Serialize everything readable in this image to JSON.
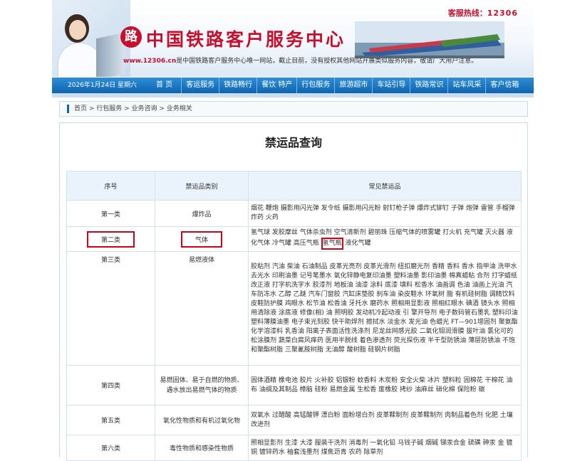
{
  "header": {
    "hotline_label": "客服热线：",
    "hotline_number": "12306",
    "site_title": "中国铁路客户服务中心",
    "notice_url": "www.12306.cn",
    "notice_text": "是中国铁路客户服务中心唯一网站，截止目前，没有授权其他网站开展类似服务内容，敬请广大用户注意。",
    "logo_glyph": "路"
  },
  "nav": {
    "date": "2026年1月24日 星期六",
    "items": [
      "首 页",
      "客运服务",
      "铁路畅行",
      "餐饮 特产",
      "行包服务",
      "旅游超市",
      "车站引导",
      "铁路常识",
      "站车风采",
      "客户信箱"
    ]
  },
  "breadcrumb": "首页 > 行包服务 > 业务咨询 > 业务相关",
  "page_title": "禁运品查询",
  "table": {
    "headers": [
      "序号",
      "禁运品类别",
      "常见禁运品"
    ],
    "rows": [
      {
        "no": "第一类",
        "category": "爆炸品",
        "items": "烟花 鞭炮 摄影用闪光弹 发令纸 摄影用闪光粉 射钉枪子弹 爆炸式铆钉 子弹 炮弹 雷管 手榴弹 炸药 火药"
      },
      {
        "no": "第二类",
        "category": "气体",
        "items_before": "氢气球 发胶摩丝 气体杀虫剂 空气清新剂 碧丽珠 压缩气体的喷雾罐 打火机 充气罐 灭火器 液化气体 冷气罐 高压气瓶 ",
        "items_highlight": "氢气瓶",
        "items_after": " 液化气罐"
      },
      {
        "no": "第三类",
        "category": "易燃液体",
        "items": "胶粘剂 汽油 柴油 石油制品 皮革光亮剂 皮革光滑剂 纽扣磨光剂 香精 香料 香水 指甲油 洗甲水 去光水 印刷油墨 记号笔墨水 氧化锌静电复印油墨 塑料油墨 影印油墨 棉真蜡粘 合剂 打字蜡纸改正液 打字机洗字水 胶漆剂 地板油 油漆 涂料 底漆 填料 松香水 油画调 色油 油画上光油 汽车防冻水 乙醇 乙醚 汽车门窗胶 汽缸床垫胶 刹车油 染皮鞋水 环氧树 脂 有机硅树脂 调精饮料 皮鞋防护膜 鸡眼水 松节油 松香油 牙托水 磨药水 照相用显影液 照相红眼水 碘酒 镜头水 照相用清除液 涂底液 修像(相) 油 照明胶 发动机冷起动液 引 擎开导剂 电子数码管石墨乳 塑料印油 塑料薄膜油墨 电子束光刻胶 快干助焊剂 擦拭水 淡金水 发光油 色蜡光 FT—901增固剂 聚氨酯化学溶漆料 乳香油 阳离子表面活性洗涤剂 尼龙丝网感光胶 二氧化钼润滑膜 拔叶油 氯化可的松涂膜剂 蔬菜白腐风痒药 医用半脱线 着色渗透剂 荧光探伤液 半干型防锈油 薄层防锈油 不饱和聚酯树脂 三聚氰胺树脂 无油醇 酸树脂 硅钢片树脂"
      },
      {
        "no": "第四类",
        "category": "易燃固体、易于自燃的物质、遇水放出易燃气体的物质",
        "items": "固体酒精 橡电池 胶片 火补胶 铝银粉 蚊香料 木炭粉 安全火柴 冰片 塑料粒 固棉花 干棉花 油布 油绸及其制品 樟脑 硅粉 易燃金属 生松香 废橡胶 拷纱 油麻丝 硝化棉 保险粉 碳"
      },
      {
        "no": "第五类",
        "category": "氧化性物质和有机过氧化物",
        "items": "双氧水 过醋酸 高锰酸钾 漂白粉 面粉增白剂 皮革鞣制剂 皮革鞣制剂 肉制品着色剂 化肥 土壤改进剂"
      },
      {
        "no": "第六类",
        "category": "毒性物质和感染性物质",
        "items": "照相显影剂 生漆 大漆 服装干洗剂 消毒剂 一氧化铅 马钱子碱 烟碱 锑汞合金 硫磺 砷汞 金 镀铜 镀锌药水 袖套浅墨剂 煤焦沥青 农药 除草剂"
      }
    ]
  },
  "colors": {
    "brand_red": "#c8102e",
    "nav_blue": "#0f64ad",
    "highlight_red": "#d0021b"
  }
}
